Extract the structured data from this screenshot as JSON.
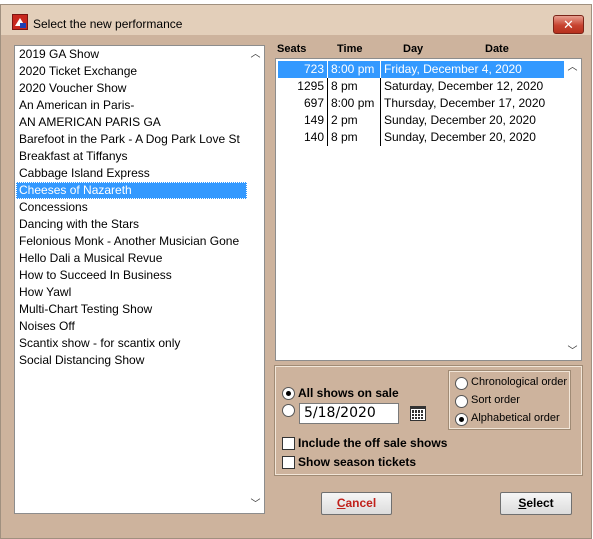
{
  "window": {
    "title": "Select the new performance",
    "close_label": "✕"
  },
  "performances": {
    "items": [
      "2019 GA Show",
      "2020 Ticket Exchange",
      "2020 Voucher Show",
      "An American in Paris-",
      "AN AMERICAN PARIS GA",
      "Barefoot in the Park - A Dog Park Love St",
      "Breakfast at Tiffanys",
      "Cabbage Island Express",
      "Cheeses of Nazareth",
      "Concessions",
      "Dancing with the Stars",
      "Felonious Monk - Another Musician Gone",
      "Hello Dali  a Musical Revue",
      "How to Succeed In Business",
      "How Yawl",
      "Multi-Chart Testing Show",
      "Noises Off",
      "Scantix show - for scantix only",
      "Social Distancing Show"
    ],
    "selected": "Cheeses of Nazareth"
  },
  "table": {
    "headers": {
      "seats": "Seats",
      "time": "Time",
      "day": "Day",
      "date": "Date"
    },
    "rows": [
      {
        "seats": "723",
        "time": "8:00 pm",
        "date": "Friday, December 4, 2020",
        "selected": true
      },
      {
        "seats": "1295",
        "time": "8 pm",
        "date": "Saturday, December 12, 2020",
        "selected": false
      },
      {
        "seats": "697",
        "time": "8:00 pm",
        "date": "Thursday, December 17, 2020",
        "selected": false
      },
      {
        "seats": "149",
        "time": "2 pm",
        "date": "Sunday, December 20, 2020",
        "selected": false
      },
      {
        "seats": "140",
        "time": "8 pm",
        "date": "Sunday, December 20, 2020",
        "selected": false
      }
    ]
  },
  "options": {
    "all_shows_label": "All shows on sale",
    "all_shows_checked": true,
    "date_checked": false,
    "date_value": "5/18/2020",
    "include_off_sale_label": "Include the off sale shows",
    "include_off_sale_checked": false,
    "season_tickets_label": "Show season tickets",
    "season_tickets_checked": false
  },
  "order": {
    "chronological_label": "Chronological order",
    "sort_label": "Sort order",
    "alphabetical_label": "Alphabetical order",
    "selected": "alphabetical"
  },
  "buttons": {
    "cancel_label_first": "C",
    "cancel_label_rest": "ancel",
    "select_label_first": "S",
    "select_label_rest": "elect"
  },
  "icons": {
    "app": "app-icon",
    "close": "close-icon",
    "calendar": "calendar-icon",
    "scroll_up": "scroll-up-icon",
    "scroll_down": "scroll-down-icon"
  },
  "colors": {
    "dialog_bg": "#cdb39d",
    "selection": "#3399ff",
    "cancel_text": "#c0201a"
  }
}
